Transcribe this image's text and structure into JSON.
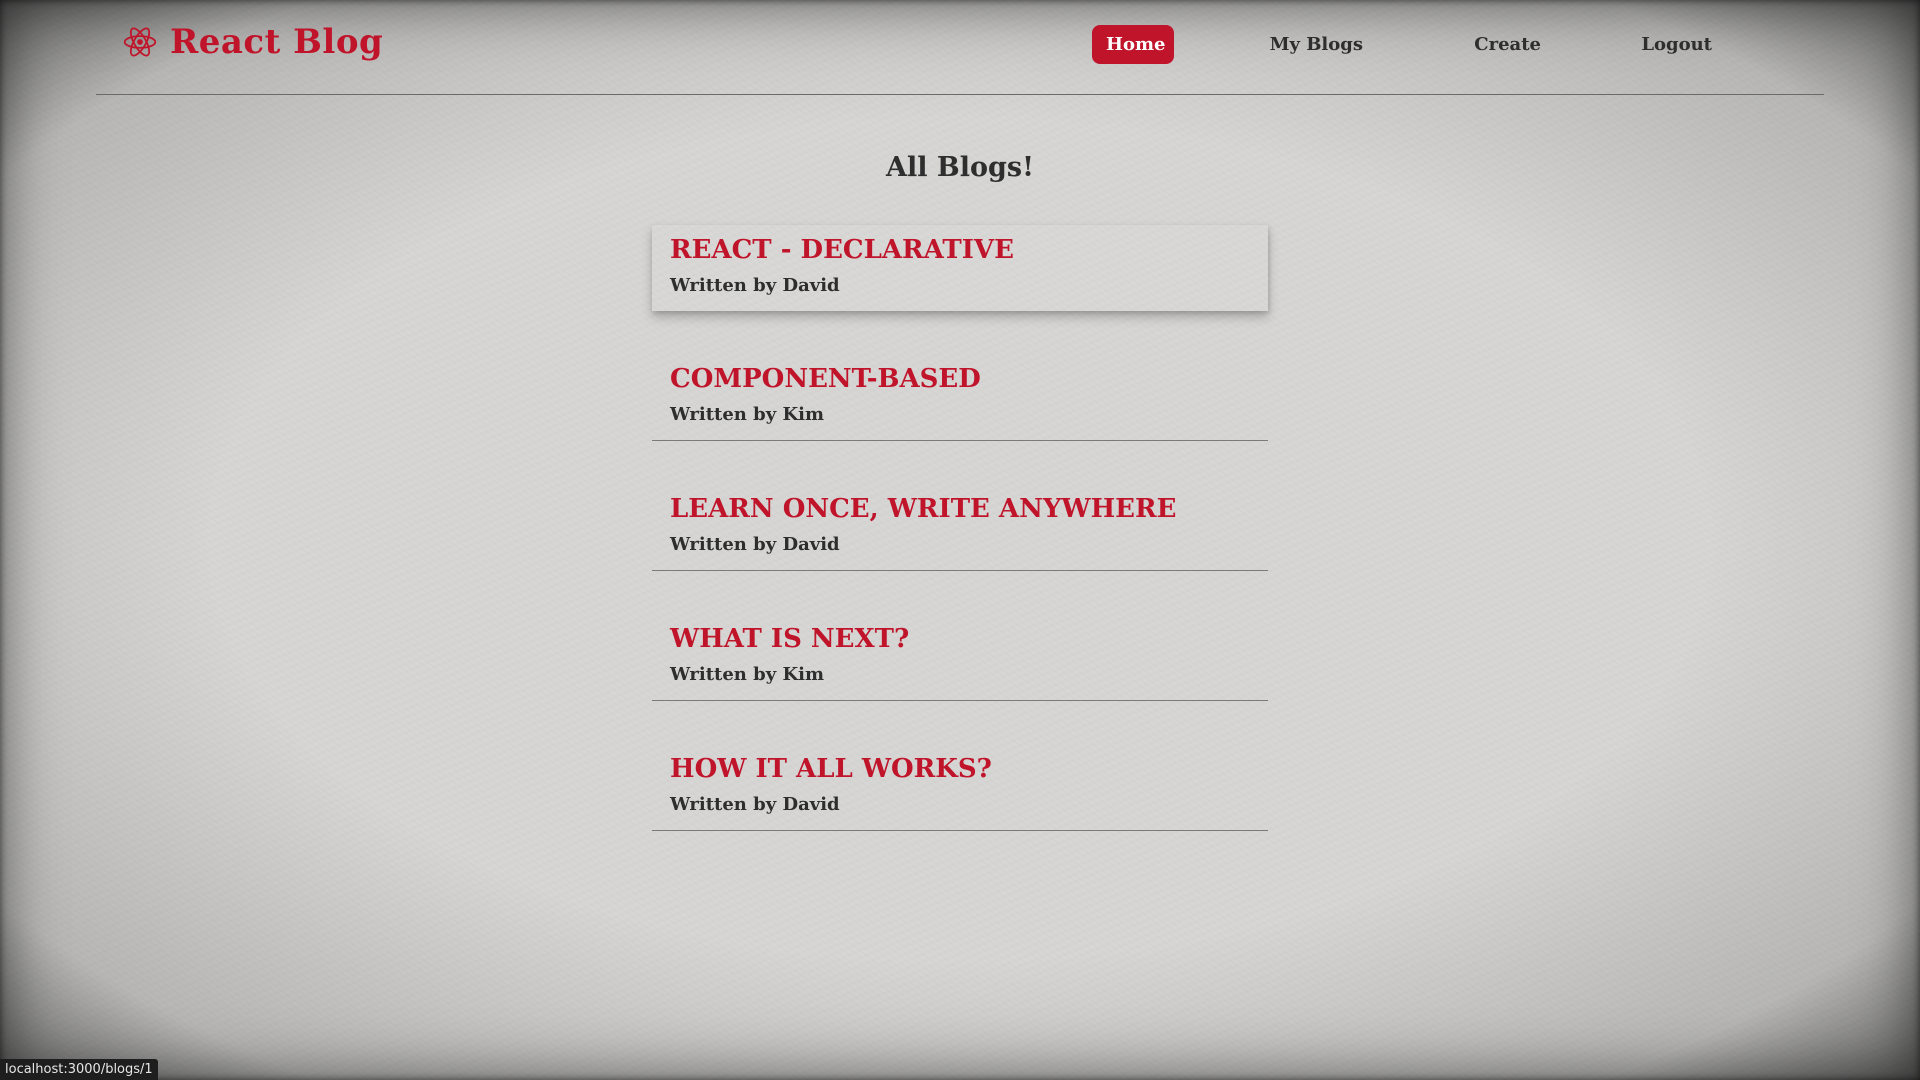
{
  "header": {
    "brand_title": "React Blog",
    "brand_icon": "react-atom-icon",
    "nav": {
      "home": "Home",
      "my_blogs": "My Blogs",
      "create": "Create",
      "logout": "Logout"
    },
    "active_nav": "home"
  },
  "main": {
    "heading": "All Blogs!",
    "blogs": [
      {
        "title": "REACT - DECLARATIVE",
        "author": "Written by David"
      },
      {
        "title": "COMPONENT-BASED",
        "author": "Written by Kim"
      },
      {
        "title": "LEARN ONCE, WRITE ANYWHERE",
        "author": "Written by David"
      },
      {
        "title": "WHAT IS NEXT?",
        "author": "Written by Kim"
      },
      {
        "title": "HOW IT ALL WORKS?",
        "author": "Written by David"
      }
    ],
    "hovered_blog_index": 0
  },
  "status_bar": {
    "url": "localhost:3000/blogs/1"
  },
  "colors": {
    "accent": "#c0142a",
    "text": "#2e2e2e",
    "background": "#d7d6d4"
  }
}
